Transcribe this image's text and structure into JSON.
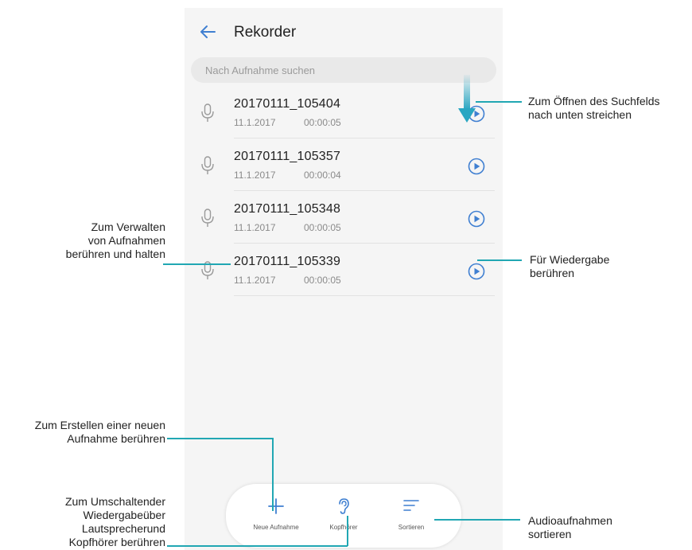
{
  "app": {
    "title": "Rekorder"
  },
  "search": {
    "placeholder": "Nach Aufnahme suchen"
  },
  "recordings": [
    {
      "name": "20170111_105404",
      "date": "11.1.2017",
      "duration": "00:00:05"
    },
    {
      "name": "20170111_105357",
      "date": "11.1.2017",
      "duration": "00:00:04"
    },
    {
      "name": "20170111_105348",
      "date": "11.1.2017",
      "duration": "00:00:05"
    },
    {
      "name": "20170111_105339",
      "date": "11.1.2017",
      "duration": "00:00:05"
    }
  ],
  "bottom_bar": {
    "new_label": "Neue Aufnahme",
    "headphones_label": "Kopfhörer",
    "sort_label": "Sortieren"
  },
  "annotations": {
    "search_swipe": [
      "Zum Öffnen des Suchfelds",
      "nach unten streichen"
    ],
    "manage": [
      "Zum Verwalten",
      "von Aufnahmen",
      "berühren und halten"
    ],
    "play": [
      "Für Wiedergabe",
      "berühren"
    ],
    "new": [
      "Zum Erstellen einer neuen",
      "Aufnahme berühren"
    ],
    "switch": [
      "Zum Umschaltender",
      "Wiedergabeüber",
      "Lautsprecherund",
      "Kopfhörer berühren"
    ],
    "sort": [
      "Audioaufnahmen",
      "sortieren"
    ]
  },
  "colors": {
    "accent": "#3f7fd1",
    "callout_line": "#21a7b3",
    "swipe_arrow": "#29a6c2"
  },
  "icons": {
    "back": "arrow-left-icon",
    "mic": "microphone-icon",
    "play": "play-circle-icon",
    "new": "plus-icon",
    "headphones": "ear-icon",
    "sort": "sort-lines-icon"
  }
}
